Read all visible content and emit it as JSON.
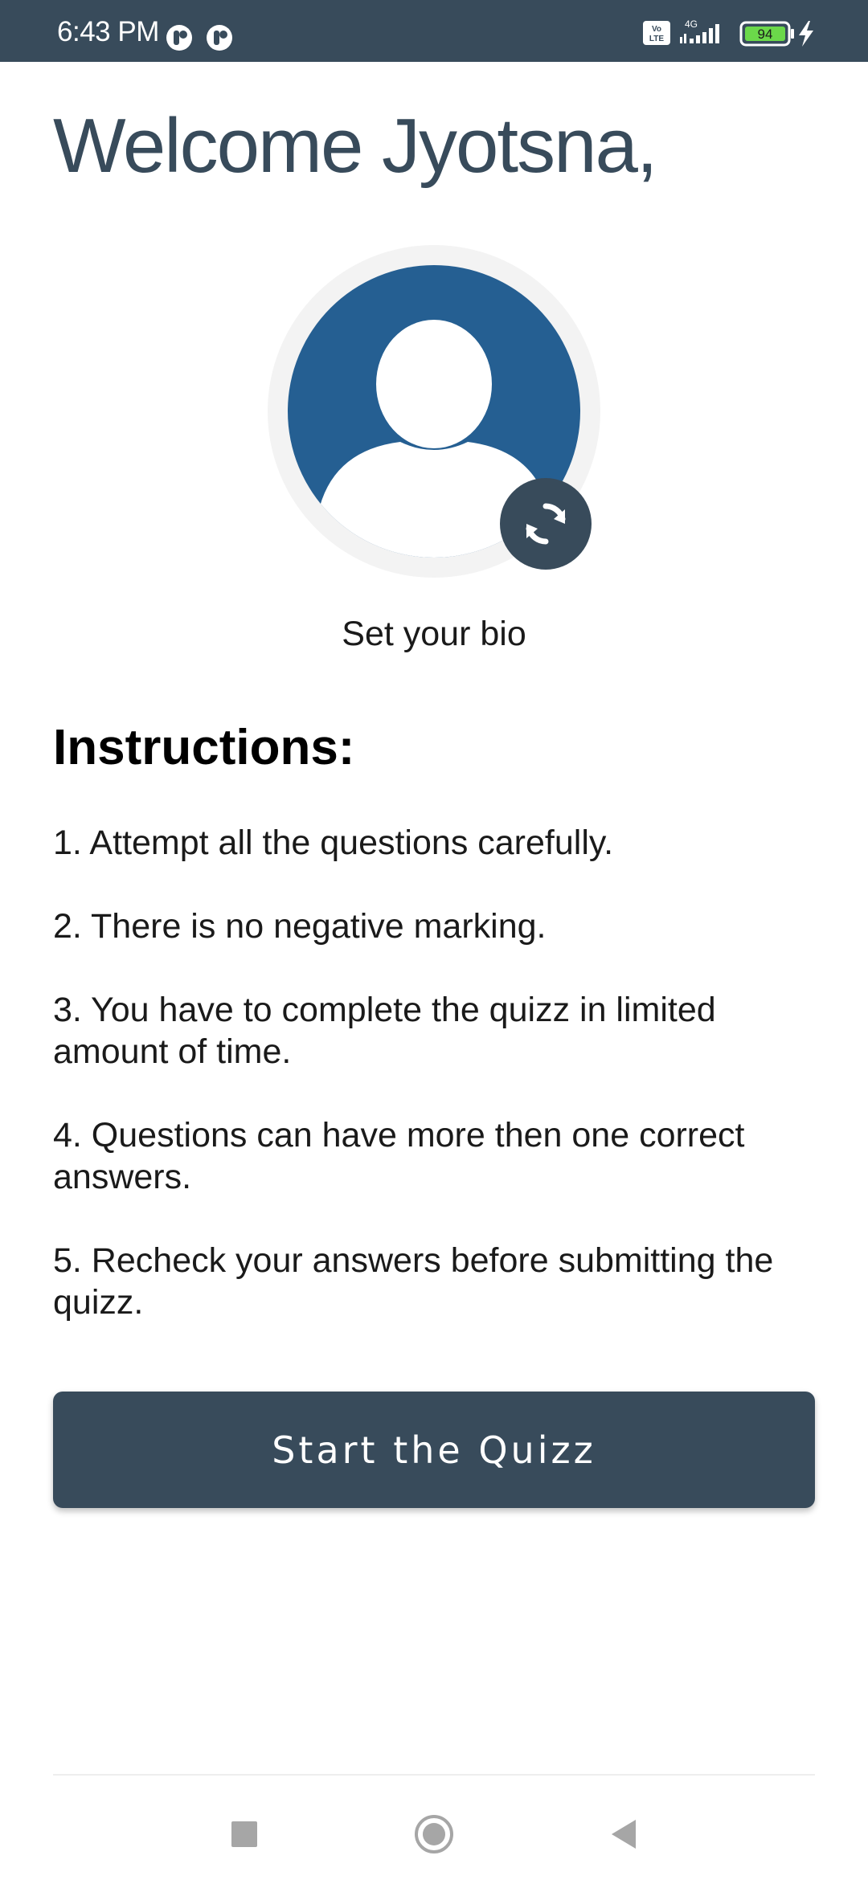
{
  "status_bar": {
    "time": "6:43 PM",
    "battery": "94",
    "network": "4G",
    "volte": "Vo LTE"
  },
  "greeting": "Welcome Jyotsna,",
  "bio_label": "Set your bio",
  "instructions": {
    "title": "Instructions:",
    "items": [
      "1. Attempt all the questions carefully.",
      "2. There is no negative marking.",
      "3. You have to complete the quizz in limited amount of time.",
      "4. Questions can have more then one correct answers.",
      "5. Recheck your answers before submitting the quizz."
    ]
  },
  "start_button": "Start the Quizz",
  "icons": {
    "avatar": "person-avatar-icon",
    "swap": "sync-icon",
    "nav_recents": "square-icon",
    "nav_home": "circle-icon",
    "nav_back": "triangle-back-icon"
  },
  "colors": {
    "primary": "#384b5b",
    "avatar_blue": "#255f92",
    "battery_green": "#6bd84a"
  }
}
